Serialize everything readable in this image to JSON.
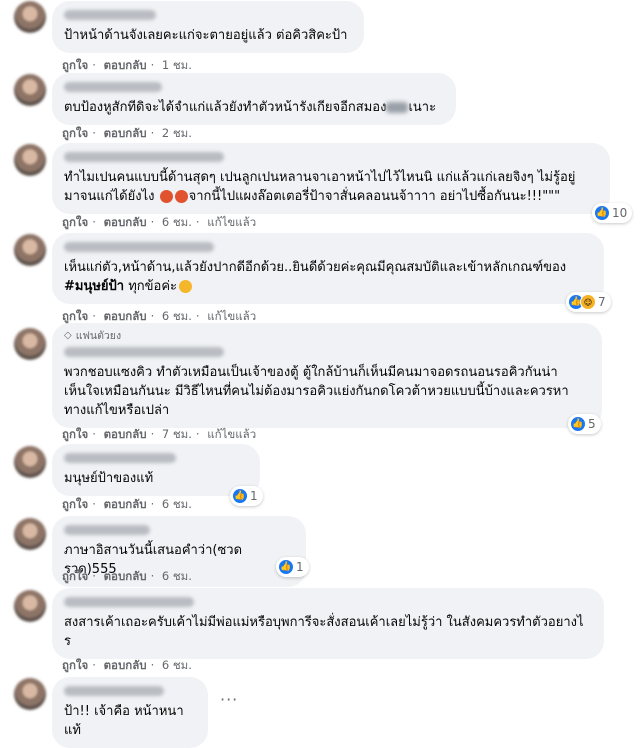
{
  "comments": [
    {
      "text": "ป้าหน้าด้านจังเลยคะแก่จะตายอยู่แล้ว ต่อคิวสิคะป้า",
      "like": "ถูกใจ",
      "reply": "ตอบกลับ",
      "time": "1 ชม."
    },
    {
      "text_a": "ตบป้องหูสักทีดิจะได้จำแก่แล้วยังทำตัวหน้ารังเกียจอีกสมอง",
      "text_b": "เนาะ",
      "like": "ถูกใจ",
      "reply": "ตอบกลับ",
      "time": "2 ชม."
    },
    {
      "line1": "ทำไมเปนคนแบบนี้ด้านสุดๆ เปนลูกเปนหลานจาเอาหน้าไปไว้ไหนนิ แก่แล้วแก่เลยจิงๆ ไม่รู้อยู่",
      "line2a": "มาจนแก่ได้ยังไง",
      "line2b": "จากนี้ไปแผงล๊อตเตอรี่ป้าจาสั่นคลอนนจ้าาาา อย่าไปซื้อกันนะ!!!\"\"\"",
      "like": "ถูกใจ",
      "reply": "ตอบกลับ",
      "time": "6 ชม.",
      "edited": "แก้ไขแล้ว",
      "reaction_count": "10"
    },
    {
      "line1": "เห็นแก่ตัว,หน้าด้าน,แล้วยังปากดีอีกด้วย..ยินดีด้วยค่ะคุณมีคุณสมบัติและเข้าหลักเกณฑ์ของ",
      "hashtag": "#มนุษย์ป้า",
      "line2": " ทุกข้อค่ะ",
      "like": "ถูกใจ",
      "reply": "ตอบกลับ",
      "time": "6 ชม.",
      "edited": "แก้ไขแล้ว",
      "reaction_count": "7"
    },
    {
      "badge": "แฟนตัวยง",
      "line1": "พวกชอบแซงคิว ทำตัวเหมือนเป็นเจ้าของตู้ ตู้ใกล้บ้านก็เห็นมีคนมาจอดรถนอนรอคิวกันน่า",
      "line2": "เห็นใจเหมือนกันนะ มีวิธีไหนที่คนไม่ต้องมารอคิวแย่งกันกดโควต้าหวยแบบนี้บ้างและควรหา",
      "line3": "ทางแก้ไขหรือเปล่า",
      "like": "ถูกใจ",
      "reply": "ตอบกลับ",
      "time": "7 ชม.",
      "edited": "แก้ไขแล้ว",
      "reaction_count": "5"
    },
    {
      "text": "มนุษย์ป้าของแท้",
      "like": "ถูกใจ",
      "reply": "ตอบกลับ",
      "time": "6 ชม.",
      "reaction_count": "1"
    },
    {
      "text": "ภาษาอิสานวันนี้เสนอคำว่า(ซวดรวด)555",
      "like": "ถูกใจ",
      "reply": "ตอบกลับ",
      "time": "6 ชม.",
      "reaction_count": "1"
    },
    {
      "line1": "สงสารเค้าเถอะครับเค้าไม่มีพ่อแม่หรือบุพการีจะสั่งสอนเค้าเลยไม่รู้ว่า ในสังคมควรทำตัวอยางไ",
      "line2": "ร",
      "like": "ถูกใจ",
      "reply": "ตอบกลับ",
      "time": "6 ชม."
    },
    {
      "text": "ป้า!! เจ้าคือ หน้าหนาแท้",
      "more": "···"
    }
  ],
  "colors": {
    "bubble": "#f0f2f5",
    "meta": "#65676b",
    "like_blue": "#1877f2"
  },
  "icons": [
    "like-reaction-icon",
    "angry-reaction-icon",
    "haha-reaction-icon",
    "fan-diamond-icon",
    "more-options-icon"
  ]
}
